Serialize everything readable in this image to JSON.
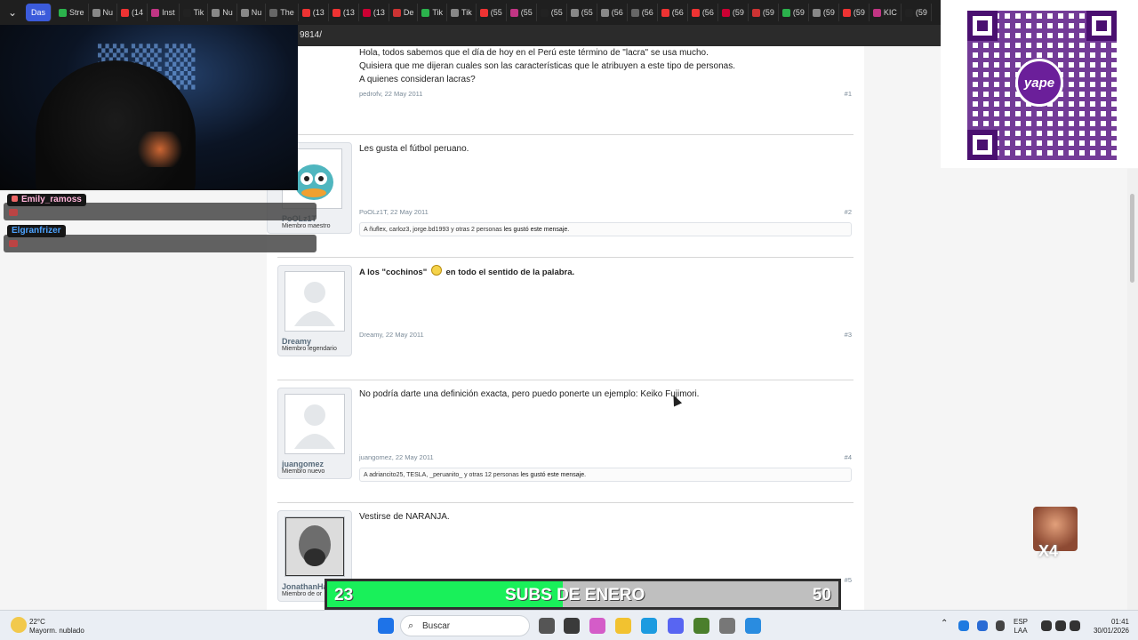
{
  "browser": {
    "active_tab": "Das",
    "tabs": [
      "Stre",
      "Nu",
      "(14",
      "Inst",
      "Tik",
      "Nu",
      "Nu",
      "The",
      "(13",
      "(13",
      "(13",
      "De",
      "Tik",
      "Tik",
      "(55",
      "(55",
      "(55",
      "(55",
      "(56",
      "(56",
      "(56",
      "(56",
      "(59",
      "(59",
      "(59",
      "(59",
      "(59",
      "KIC",
      "(59"
    ],
    "url_fragment": "9814/"
  },
  "posts": [
    {
      "lines": [
        "Hola, todos sabemos que el día de hoy en el Perú este término de \"lacra\" se usa mucho.",
        "Quisiera que me dijeran cuales son las características que le atribuyen a este tipo de personas.",
        "A quienes consideran lacras?"
      ],
      "meta": "pedrofv, 22 May 2011",
      "num": "#1"
    },
    {
      "username": "PoOLz1T",
      "rank": "Miembro maestro",
      "text": "Les gusta el fútbol peruano.",
      "meta": "PoOLz1T, 22 May 2011",
      "num": "#2",
      "likes_pre": "A ñuflex, carloz3, jorge.bd1993 y otras 2 personas",
      "likes_post": "les gustó este mensaje."
    },
    {
      "username": "Dreamy",
      "rank": "Miembro legendario",
      "text_a": "A los \"cochinos\"",
      "text_b": "en todo el sentido de la palabra.",
      "meta": "Dreamy, 22 May 2011",
      "num": "#3"
    },
    {
      "username": "juangomez",
      "rank": "Miembro nuevo",
      "text": "No podría darte una definición exacta, pero puedo ponerte un ejemplo: Keiko Fujimori.",
      "meta": "juangomez, 22 May 2011",
      "num": "#4",
      "likes_pre": "A adriancito25, TESLA, _peruanito_ y otras 12 personas",
      "likes_post": "les gustó este mensaje."
    },
    {
      "username": "JonathanHa",
      "rank": "Miembro de or",
      "text": "Vestirse de NARANJA.",
      "num": "#5"
    }
  ],
  "stream": {
    "chat": [
      {
        "name": "Emily_ramoss",
        "color": "#ffb3d9"
      },
      {
        "name": "Elgranfrizer",
        "color": "#4da3ff"
      }
    ],
    "qr_brand": "yape",
    "subs": {
      "current": "23",
      "label": "SUBS DE ENERO",
      "goal": "50",
      "progress": 0.46
    },
    "emote_text": "X4"
  },
  "taskbar": {
    "weather_temp": "22°C",
    "weather_desc": "Mayorm. nublado",
    "search_placeholder": "Buscar",
    "lang_1": "ESP",
    "lang_2": "LAA",
    "time": "01:41",
    "date": "30/01/2026"
  },
  "colors": {
    "subs_fill": "#19f05a",
    "qr_purple": "#5b1a86",
    "taskbar_bg": "#eaeef4"
  }
}
